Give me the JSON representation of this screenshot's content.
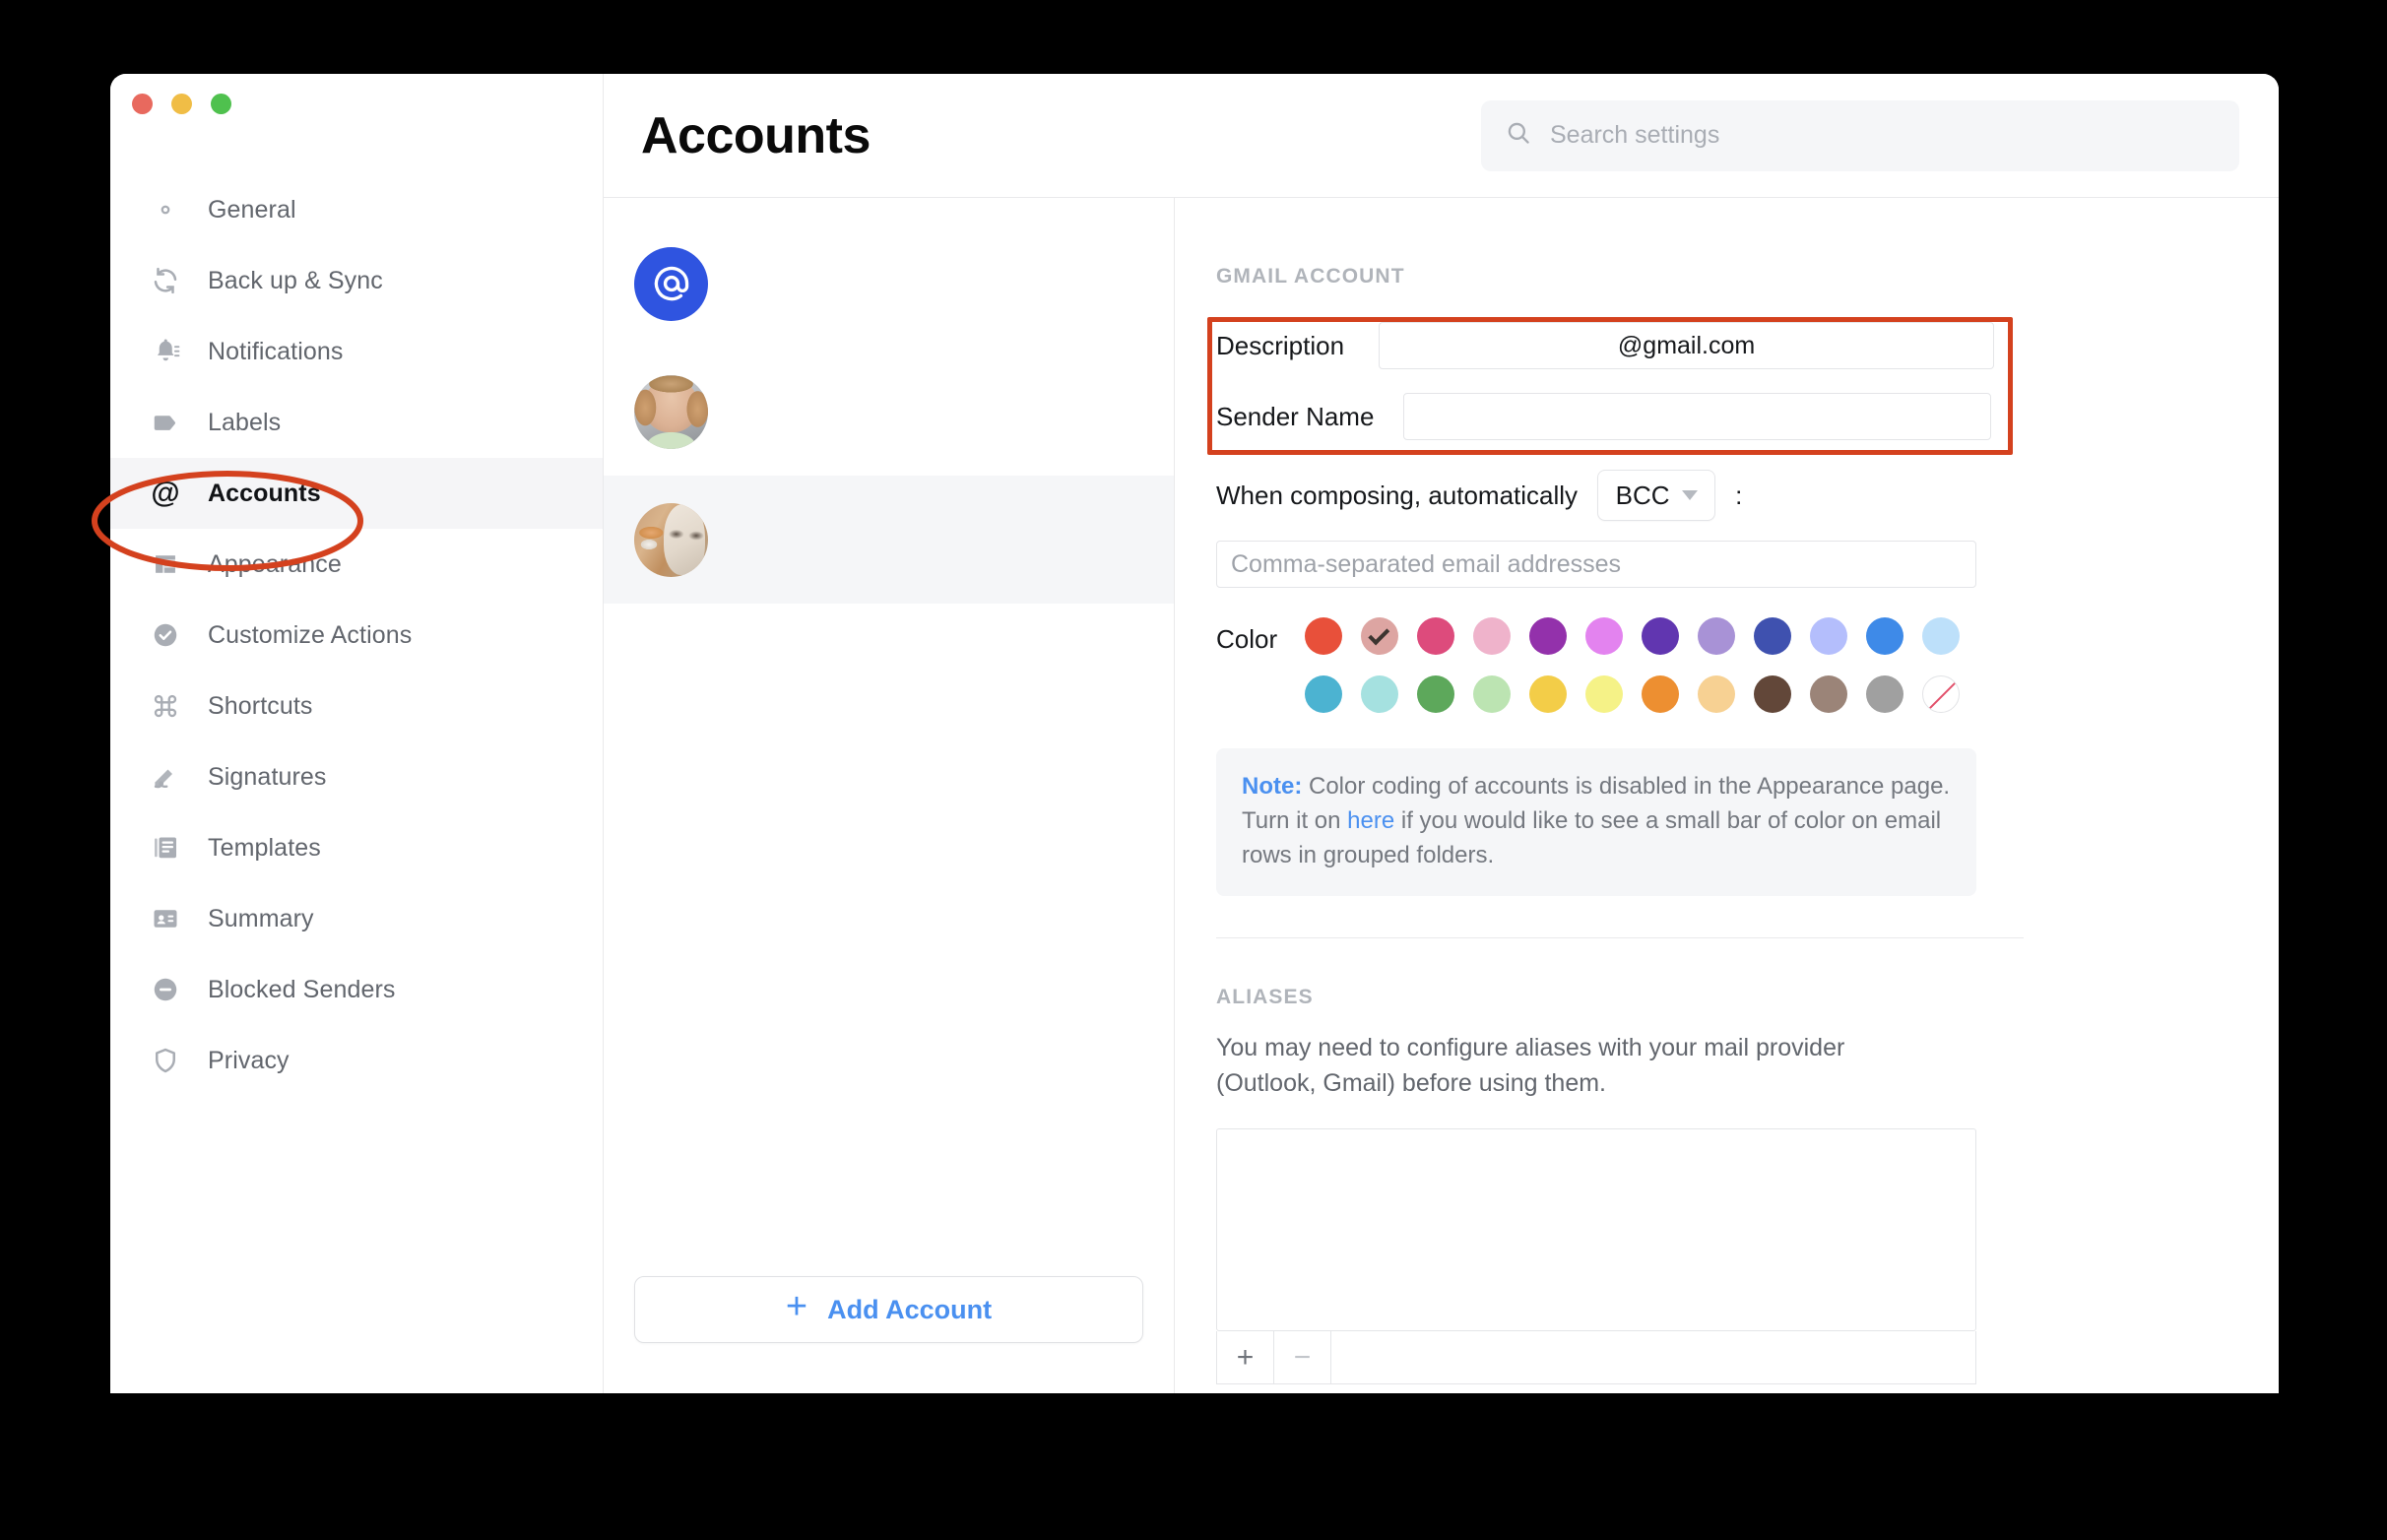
{
  "window": {
    "traffic_lights": [
      "close",
      "minimize",
      "zoom"
    ]
  },
  "sidebar": {
    "items": [
      {
        "id": "general",
        "label": "General",
        "icon": "gear-icon",
        "active": false
      },
      {
        "id": "backup-sync",
        "label": "Back up & Sync",
        "icon": "sync-icon",
        "active": false
      },
      {
        "id": "notifications",
        "label": "Notifications",
        "icon": "bell-icon",
        "active": false
      },
      {
        "id": "labels",
        "label": "Labels",
        "icon": "tag-icon",
        "active": false
      },
      {
        "id": "accounts",
        "label": "Accounts",
        "icon": "at-sign-icon",
        "active": true
      },
      {
        "id": "appearance",
        "label": "Appearance",
        "icon": "layout-icon",
        "active": false
      },
      {
        "id": "customize-actions",
        "label": "Customize Actions",
        "icon": "check-circle-icon",
        "active": false
      },
      {
        "id": "shortcuts",
        "label": "Shortcuts",
        "icon": "command-icon",
        "active": false
      },
      {
        "id": "signatures",
        "label": "Signatures",
        "icon": "signature-pen-icon",
        "active": false
      },
      {
        "id": "templates",
        "label": "Templates",
        "icon": "documents-icon",
        "active": false
      },
      {
        "id": "summary",
        "label": "Summary",
        "icon": "id-card-icon",
        "active": false
      },
      {
        "id": "blocked-senders",
        "label": "Blocked Senders",
        "icon": "minus-circle-icon",
        "active": false
      },
      {
        "id": "privacy",
        "label": "Privacy",
        "icon": "shield-icon",
        "active": false
      }
    ]
  },
  "header": {
    "title": "Accounts",
    "search": {
      "placeholder": "Search settings",
      "value": "",
      "icon": "search-icon"
    }
  },
  "accounts_list": {
    "rows": [
      {
        "id": "account-1",
        "avatar": "at-sign-avatar",
        "selected": false
      },
      {
        "id": "account-2",
        "avatar": "person-photo",
        "selected": false
      },
      {
        "id": "account-3",
        "avatar": "cat-statue-photo",
        "selected": true
      }
    ],
    "add_account": {
      "label": "Add Account",
      "icon": "plus-icon"
    }
  },
  "detail": {
    "gmail_account": {
      "heading": "GMAIL ACCOUNT",
      "description_label": "Description",
      "description_value": "@gmail.com",
      "sender_name_label": "Sender Name",
      "sender_name_value": "",
      "compose_label": "When composing, automatically",
      "compose_mode": "BCC",
      "compose_colon": ":",
      "bcc_placeholder": "Comma-separated email addresses",
      "bcc_value": "",
      "color_label": "Color",
      "colors": [
        {
          "name": "red",
          "hex": "#e8503a",
          "selected": false
        },
        {
          "name": "dusty-rose",
          "hex": "#dda5a2",
          "selected": true
        },
        {
          "name": "deep-pink",
          "hex": "#dd4b7c",
          "selected": false
        },
        {
          "name": "light-pink",
          "hex": "#efb3cb",
          "selected": false
        },
        {
          "name": "purple",
          "hex": "#9331ab",
          "selected": false
        },
        {
          "name": "orchid",
          "hex": "#e383ef",
          "selected": false
        },
        {
          "name": "violet",
          "hex": "#6136b0",
          "selected": false
        },
        {
          "name": "light-violet",
          "hex": "#a892d6",
          "selected": false
        },
        {
          "name": "indigo",
          "hex": "#3f51af",
          "selected": false
        },
        {
          "name": "periwinkle",
          "hex": "#b4befc",
          "selected": false
        },
        {
          "name": "blue",
          "hex": "#3e8ae8",
          "selected": false
        },
        {
          "name": "light-blue",
          "hex": "#bde0fa",
          "selected": false
        },
        {
          "name": "teal",
          "hex": "#4cb3d1",
          "selected": false
        },
        {
          "name": "light-teal",
          "hex": "#a5e1e0",
          "selected": false
        },
        {
          "name": "green",
          "hex": "#5da85b",
          "selected": false
        },
        {
          "name": "light-green",
          "hex": "#bce4b2",
          "selected": false
        },
        {
          "name": "yellow",
          "hex": "#f3cd48",
          "selected": false
        },
        {
          "name": "light-yellow",
          "hex": "#f5f287",
          "selected": false
        },
        {
          "name": "orange",
          "hex": "#ed8f31",
          "selected": false
        },
        {
          "name": "light-orange",
          "hex": "#f7d193",
          "selected": false
        },
        {
          "name": "brown",
          "hex": "#624739",
          "selected": false
        },
        {
          "name": "taupe",
          "hex": "#9b8478",
          "selected": false
        },
        {
          "name": "gray",
          "hex": "#a0a0a0",
          "selected": false
        },
        {
          "name": "none",
          "hex": "#ffffff",
          "selected": false
        }
      ],
      "note": {
        "label": "Note:",
        "text_before_link": " Color coding of accounts is disabled in the Appearance page. Turn it on ",
        "link": "here",
        "text_after_link": " if you would like to see a small bar of color on email rows in grouped folders."
      }
    },
    "aliases": {
      "heading": "ALIASES",
      "description": "You may need to configure aliases with your mail provider (Outlook, Gmail) before using them.",
      "items": [],
      "add_button": "+",
      "remove_button": "−"
    }
  },
  "annotations": {
    "accents": {
      "red": "#d4411e"
    },
    "highlighted_sidebar_item": "Accounts",
    "highlighted_fields": [
      "Description",
      "Sender Name"
    ]
  }
}
